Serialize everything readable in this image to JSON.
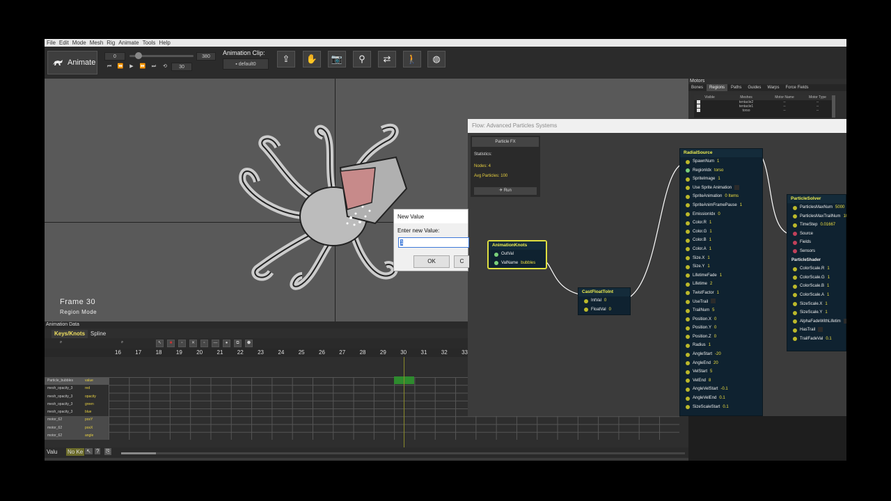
{
  "menu": [
    "File",
    "Edit",
    "Mode",
    "Mesh",
    "Rig",
    "Animate",
    "Tools",
    "Help"
  ],
  "toolbar": {
    "mode_button": "Animate",
    "start_frame": "0",
    "end_frame": "380",
    "step": "30",
    "clip_label": "Animation Clip:",
    "clip_value": "default0"
  },
  "viewport": {
    "frame": "Frame 30",
    "mode": "Region Mode"
  },
  "motors": {
    "title": "Motors",
    "tabs": [
      "Bones",
      "Regions",
      "Paths",
      "Guides",
      "Warps",
      "Force Fields"
    ],
    "headers": [
      "Visible",
      "Meshes",
      "Motor Name",
      "Motor Type"
    ],
    "rows": [
      {
        "mesh": "tentacle2",
        "name": "--",
        "type": "--"
      },
      {
        "mesh": "tentacle1",
        "name": "--",
        "type": "--"
      },
      {
        "mesh": "torso",
        "name": "--",
        "type": "--"
      }
    ]
  },
  "animation_data": {
    "title": "Animation Data",
    "tabs": [
      "Keys/Knots",
      "Spline"
    ],
    "ruler": [
      "16",
      "17",
      "18",
      "19",
      "20",
      "21",
      "22",
      "23",
      "24",
      "25",
      "26",
      "27",
      "28",
      "29",
      "30",
      "31",
      "32",
      "33"
    ],
    "tracks": [
      {
        "name": "Particle_bubbles",
        "prop": "value"
      },
      {
        "name": "mesh_opacity_3",
        "prop": "red"
      },
      {
        "name": "mesh_opacity_3",
        "prop": "opacity"
      },
      {
        "name": "mesh_opacity_3",
        "prop": "green"
      },
      {
        "name": "mesh_opacity_3",
        "prop": "blue"
      },
      {
        "name": "motor_62",
        "prop": "posY"
      },
      {
        "name": "motor_62",
        "prop": "posX"
      },
      {
        "name": "motor_62",
        "prop": "angle"
      }
    ],
    "status_value": "Valu",
    "status_nokey": "No Ke"
  },
  "flow": {
    "title": "Flow: Advanced Particles Systems",
    "panel_button": "Particle FX",
    "statistics": "Statistics:",
    "nodes": "Nodes: 4",
    "avg": "Avg Particles: 100",
    "run": "Run",
    "animation_knots": {
      "title": "AnimationKnots",
      "ports": [
        {
          "label": "OutVal",
          "val": ""
        },
        {
          "label": "ValName",
          "val": "bubbles"
        }
      ]
    },
    "cast_node": {
      "title": "CastFloatToInt",
      "ports": [
        {
          "label": "IntVal",
          "val": "0"
        },
        {
          "label": "FloatVal",
          "val": "0"
        }
      ]
    },
    "radial_source": {
      "title": "RadialSource",
      "ports": [
        {
          "label": "SpawnNum",
          "val": "1"
        },
        {
          "label": "RegionIdx",
          "val": "torso"
        },
        {
          "label": "SpriteImage",
          "val": "1"
        },
        {
          "label": "Use Sprite Animation",
          "val": ""
        },
        {
          "label": "SpriteAnimation",
          "val": "0 Items"
        },
        {
          "label": "SpriteAnimFramePause",
          "val": "1"
        },
        {
          "label": "EmissionIdx",
          "val": "0"
        },
        {
          "label": "Color.R",
          "val": "1"
        },
        {
          "label": "Color.G",
          "val": "1"
        },
        {
          "label": "Color.B",
          "val": "1"
        },
        {
          "label": "Color.A",
          "val": "1"
        },
        {
          "label": "Size.X",
          "val": "1"
        },
        {
          "label": "Size.Y",
          "val": "1"
        },
        {
          "label": "LifetimeFade",
          "val": "1"
        },
        {
          "label": "Lifetime",
          "val": "2"
        },
        {
          "label": "TwistFactor",
          "val": "1"
        },
        {
          "label": "UseTrail",
          "val": ""
        },
        {
          "label": "TrailNum",
          "val": "5"
        },
        {
          "label": "Position.X",
          "val": "0"
        },
        {
          "label": "Position.Y",
          "val": "0"
        },
        {
          "label": "Position.Z",
          "val": "0"
        },
        {
          "label": "Radius",
          "val": "1"
        },
        {
          "label": "AngleStart",
          "val": "-20"
        },
        {
          "label": "AngleEnd",
          "val": "20"
        },
        {
          "label": "VelStart",
          "val": "5"
        },
        {
          "label": "VelEnd",
          "val": "8"
        },
        {
          "label": "AngleVelStart",
          "val": "-0.1"
        },
        {
          "label": "AngleVelEnd",
          "val": "0.1"
        },
        {
          "label": "SizeScaleStart",
          "val": "0.1"
        }
      ]
    },
    "particle_solver": {
      "title": "ParticleSolver",
      "ports": [
        {
          "label": "ParticlesMaxNum",
          "val": "5000"
        },
        {
          "label": "ParticlesMaxTrailNum",
          "val": "10"
        },
        {
          "label": "TimeStep",
          "val": "0.01667"
        },
        {
          "label": "Source",
          "val": ""
        },
        {
          "label": "Fields",
          "val": ""
        },
        {
          "label": "Sensors",
          "val": ""
        }
      ],
      "shader_label": "ParticleShader",
      "shader_ports": [
        {
          "label": "ColorScale.R",
          "val": "1"
        },
        {
          "label": "ColorScale.G",
          "val": "1"
        },
        {
          "label": "ColorScale.B",
          "val": "1"
        },
        {
          "label": "ColorScale.A",
          "val": "1"
        },
        {
          "label": "SizeScale.X",
          "val": "1"
        },
        {
          "label": "SizeScale.Y",
          "val": "1"
        },
        {
          "label": "AlphaFadeWithLifetim",
          "val": ""
        },
        {
          "label": "HasTrail",
          "val": ""
        },
        {
          "label": "TrailFadeVal",
          "val": "0.1"
        }
      ]
    }
  },
  "dialog": {
    "title": "New Value",
    "prompt": "Enter new Value:",
    "value": "1",
    "ok": "OK",
    "cancel": "C"
  }
}
